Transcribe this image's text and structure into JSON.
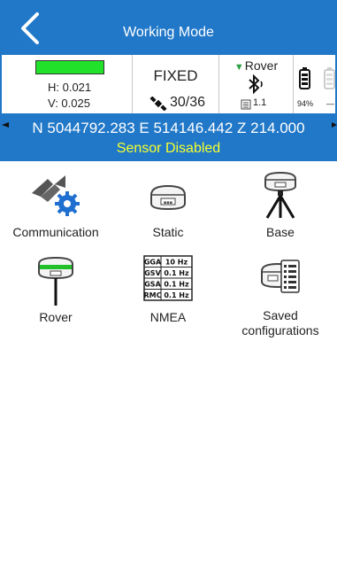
{
  "header": {
    "title": "Working Mode"
  },
  "status": {
    "h_precision": "H: 0.021",
    "v_precision": "V: 0.025",
    "solution": "FIXED",
    "satellites": "30/36",
    "mode": "Rover",
    "correction_age": "1.1",
    "battery_percent": "94%",
    "battery2_text": "—",
    "quality_color": "#22e12a"
  },
  "position": {
    "coordinates": "N 5044792.283 E 514146.442 Z 214.000",
    "sensor_status": "Sensor Disabled"
  },
  "menu": [
    {
      "label": "Communication",
      "icon": "communication-settings-icon"
    },
    {
      "label": "Static",
      "icon": "static-receiver-icon"
    },
    {
      "label": "Base",
      "icon": "base-tripod-icon"
    },
    {
      "label": "Rover",
      "icon": "rover-pole-icon"
    },
    {
      "label": "NMEA",
      "icon": "nmea-table-icon"
    },
    {
      "label": "Saved configurations",
      "icon": "saved-configurations-icon"
    }
  ],
  "nmea_table": [
    {
      "msg": "GGA",
      "rate": "10 Hz"
    },
    {
      "msg": "GSV",
      "rate": "0.1 Hz"
    },
    {
      "msg": "GSA",
      "rate": "0.1 Hz"
    },
    {
      "msg": "RMC",
      "rate": "0.1 Hz"
    }
  ],
  "colors": {
    "brand_blue": "#2178c8",
    "sensor_yellow": "#f6ff2e",
    "rover_green": "#2ea043"
  }
}
